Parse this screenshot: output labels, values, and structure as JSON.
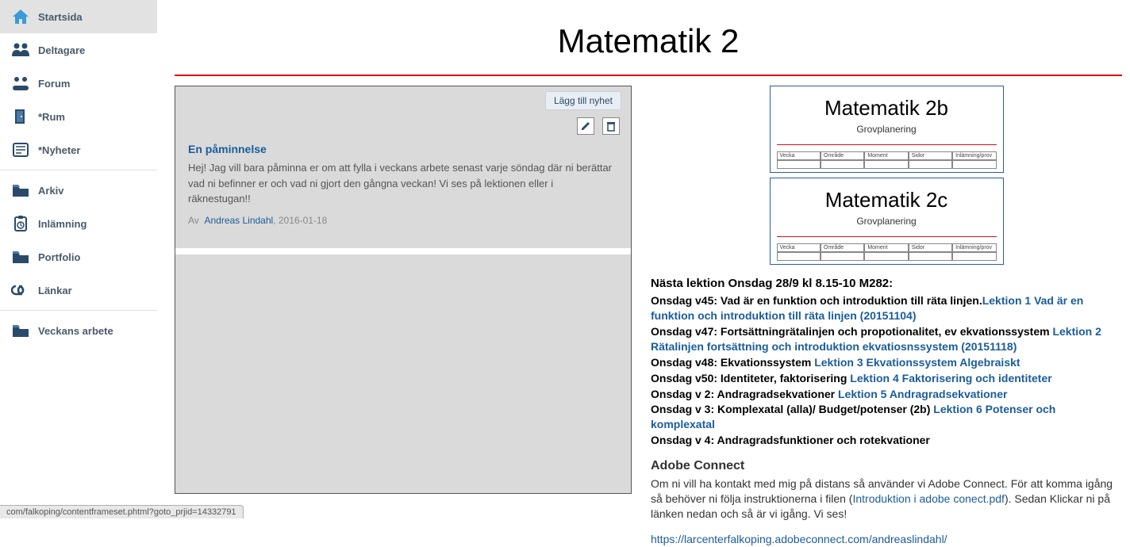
{
  "sidebar": {
    "group1": [
      {
        "icon": "home",
        "label": "Startsida",
        "active": true
      },
      {
        "icon": "people",
        "label": "Deltagare"
      },
      {
        "icon": "forum",
        "label": "Forum"
      },
      {
        "icon": "door",
        "label": "*Rum"
      },
      {
        "icon": "news",
        "label": "*Nyheter"
      }
    ],
    "group2": [
      {
        "icon": "folder",
        "label": "Arkiv"
      },
      {
        "icon": "clipboard",
        "label": "Inlämning"
      },
      {
        "icon": "folder",
        "label": "Portfolio"
      },
      {
        "icon": "link",
        "label": "Länkar"
      }
    ],
    "group3": [
      {
        "icon": "folder",
        "label": "Veckans arbete"
      }
    ]
  },
  "page_title": "Matematik 2",
  "news": {
    "add_label": "Lägg till nyhet",
    "items": [
      {
        "title": "En påminnelse",
        "body": "Hej! Jag vill bara påminna er om att fylla i veckans arbete senast varje söndag där ni berättar vad ni befinner er och vad ni gjort den gångna veckan! Vi ses på lektionen eller i räknestugan!!",
        "by_prefix": "Av",
        "author": "Andreas Lindahl",
        "date": "2016-01-18"
      }
    ]
  },
  "thumbs": [
    {
      "title": "Matematik 2b",
      "sub": "Grovplanering",
      "headers": [
        "Vecka",
        "Område",
        "Moment",
        "Sidor",
        "Inlämning/prov"
      ]
    },
    {
      "title": "Matematik 2c",
      "sub": "Grovplanering",
      "headers": [
        "Vecka",
        "Område",
        "Moment",
        "Sidor",
        "Inlämning/prov"
      ]
    }
  ],
  "schedule": {
    "header": "Nästa lektion Onsdag 28/9 kl 8.15-10 M282:",
    "lines": [
      {
        "text": "Onsdag v45: Vad är en funktion och introduktion till räta linjen.",
        "link": "Lektion 1 Vad är en funktion och introduktion till räta linjen (20151104)"
      },
      {
        "text": "Onsdag v47: Fortsättningrätalinjen och propotionalitet, ev ekvationssystem ",
        "link": "Lektion 2 Rätalinjen fortsättning och introduktion ekvatiosnssystem (20151118)"
      },
      {
        "text": "Onsdag v48: Ekvationssystem ",
        "link": "Lektion 3 Ekvationssystem Algebraiskt"
      },
      {
        "text": "Onsdag v50: Identiteter, faktorisering ",
        "link": "Lektion 4 Faktorisering och identiteter"
      },
      {
        "text": "Onsdag v 2: Andragradsekvationer ",
        "link": "Lektion 5 Andragradsekvationer"
      },
      {
        "text": "Onsdag v 3: Komplexatal (alla)/ Budget/potenser (2b) ",
        "link": "Lektion 6 Potenser och komplexatal"
      },
      {
        "text": "Onsdag v 4: Andragradsfunktioner och rotekvationer",
        "link": ""
      }
    ],
    "adobe_header": "Adobe Connect",
    "adobe_text_1": "Om ni vill ha kontakt med mig på distans så använder vi Adobe Connect. För att komma igång så behöver ni följa instruktionerna i filen (",
    "adobe_link": "Introduktion i adobe conect.pdf",
    "adobe_text_2": "). Sedan Klickar ni på länken nedan och så är vi igång. Vi ses!",
    "adobe_url": "https://larcenterfalkoping.adobeconnect.com/andreaslindahl/"
  },
  "status": "com/falkoping/contentframeset.phtml?goto_prjid=14332791"
}
